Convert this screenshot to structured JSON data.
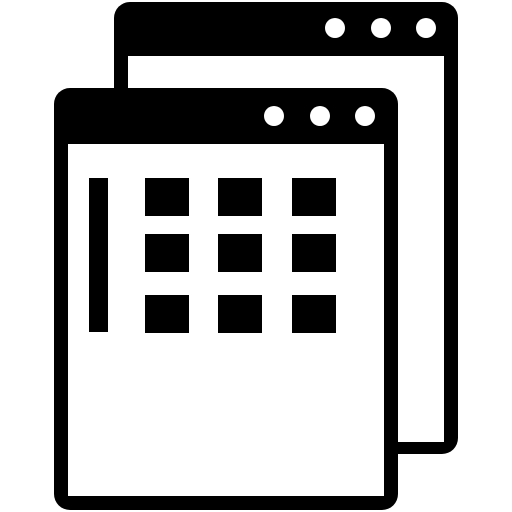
{
  "icon": {
    "name": "multiple-windows-icon",
    "colors": {
      "stroke": "#000000",
      "fill_light": "#ffffff"
    },
    "back_window": {
      "title_bar_dots": 3
    },
    "front_window": {
      "title_bar_dots": 3,
      "grid": {
        "rows": 3,
        "columns": 3
      }
    }
  }
}
